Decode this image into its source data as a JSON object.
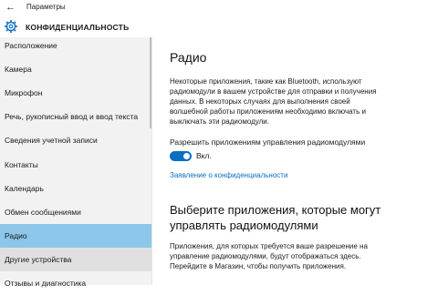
{
  "window": {
    "back_glyph": "←",
    "title": "Параметры"
  },
  "header": {
    "icon": "gear-icon",
    "title": "КОНФИДЕНЦИАЛЬНОСТЬ"
  },
  "sidebar": {
    "items": [
      {
        "label": "Расположение"
      },
      {
        "label": "Камера"
      },
      {
        "label": "Микрофон"
      },
      {
        "label": "Речь, рукописный ввод и ввод текста"
      },
      {
        "label": "Сведения учетной записи"
      },
      {
        "label": "Контакты"
      },
      {
        "label": "Календарь"
      },
      {
        "label": "Обмен сообщениями"
      },
      {
        "label": "Радио",
        "selected": true
      },
      {
        "label": "Другие устройства"
      },
      {
        "label": "Отзывы и диагностика"
      }
    ]
  },
  "main": {
    "title": "Радио",
    "description": "Некоторые приложения, такие как Bluetooth, используют радиомодули в вашем устройстве для отправки и получения данных. В некоторых случаях для выполнения своей волшебной работы приложениям необходимо включать и выключать эти радиомодули.",
    "toggle_caption": "Разрешить приложениям управления радиомодулями",
    "toggle_state": "Вкл.",
    "privacy_link": "Заявление о конфиденциальности",
    "choose_title": "Выберите приложения, которые могут управлять радиомодулями",
    "choose_text": "Приложения, для которых требуется ваше разрешение на управление радиомодулями, будут отображаться здесь. Перейдите в Магазин, чтобы получить приложения."
  },
  "colors": {
    "accent": "#0a6fc2",
    "selected_item": "#8cc6e8",
    "sidebar_bg": "#f2f2f2"
  }
}
